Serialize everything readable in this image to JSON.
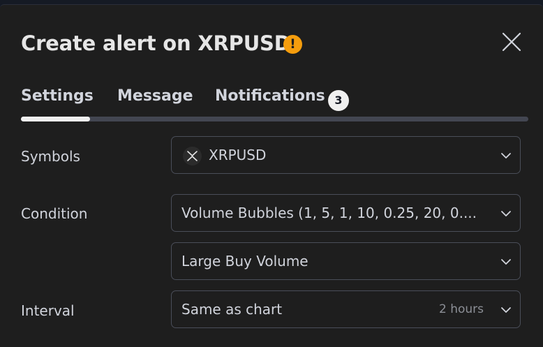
{
  "dialog": {
    "title": "Create alert on XRPUSD",
    "warning_glyph": "!",
    "warning_color": "#f59d0d",
    "close_icon": "close-icon"
  },
  "tabs": [
    {
      "label": "Settings",
      "active": true
    },
    {
      "label": "Message",
      "active": false
    },
    {
      "label": "Notifications",
      "active": false,
      "badge": "3"
    }
  ],
  "form": {
    "symbols": {
      "label": "Symbols",
      "value": "XRPUSD",
      "icon": "xrp-logo-icon"
    },
    "condition": {
      "label": "Condition",
      "value": "Volume Bubbles (1, 5, 1, 10, 0.25, 20, 0....",
      "value2": "Large Buy Volume"
    },
    "interval": {
      "label": "Interval",
      "value": "Same as chart",
      "hint": "2 hours"
    }
  },
  "colors": {
    "background": "#1e1e1e",
    "text": "#d1d4dc",
    "border": "#4a4e59",
    "accent": "#f0f0f0"
  }
}
